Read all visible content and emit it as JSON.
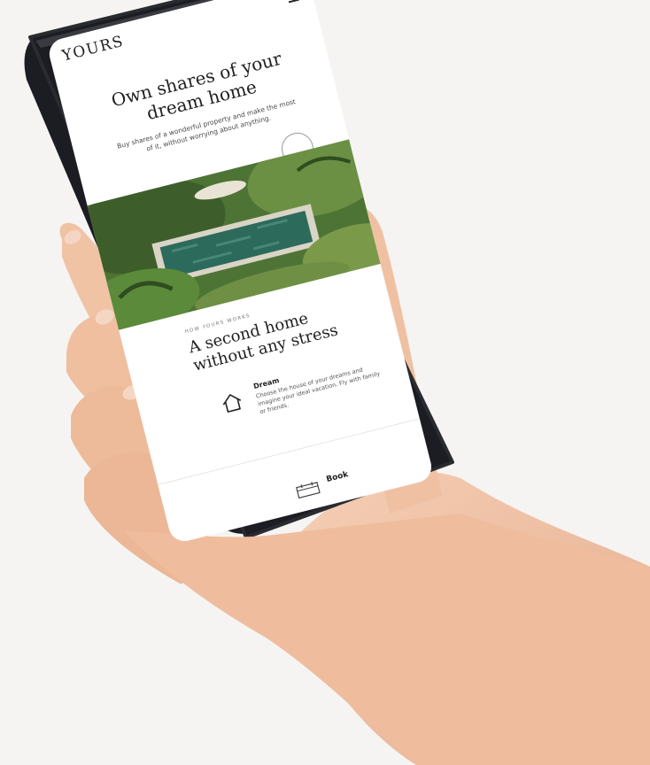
{
  "app": {
    "logo": "YOURS",
    "menu_icon": "hamburger-menu-icon"
  },
  "hero": {
    "title": "Own shares of your dream home",
    "subtitle": "Buy shares of a wonderful property and make the most of it, without worrying about anything."
  },
  "how_it_works": {
    "eyebrow": "HOW YOURS WORKS",
    "title": "A second home without any stress",
    "feature": {
      "icon": "house-icon",
      "title": "Dream",
      "description": "Choose the house of your dreams and imagine your ideal vacation. Fly with family or friends."
    }
  },
  "bottom_bar": {
    "icon": "calendar-icon",
    "label": "Book"
  },
  "colors": {
    "background": "#f5f4f2",
    "skin": "#f0c5a8",
    "phone_frame": "#1c1d22",
    "pool_water": "#2c6a5c",
    "foliage": "#5f8a3e"
  }
}
